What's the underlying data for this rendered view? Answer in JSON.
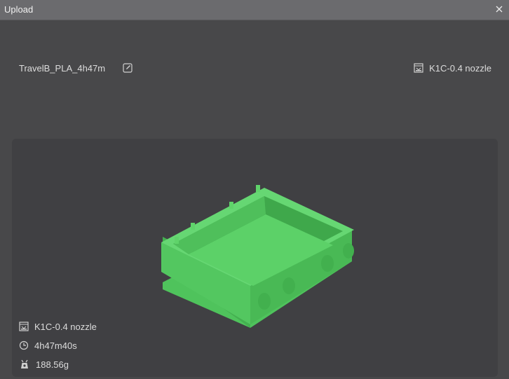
{
  "window": {
    "title": "Upload"
  },
  "header": {
    "filename": "TravelB_PLA_4h47m",
    "printer": "K1C-0.4 nozzle"
  },
  "details": {
    "printer": "K1C-0.4 nozzle",
    "print_time": "4h47m40s",
    "weight": "188.56g"
  },
  "icons": {
    "close": "close-icon",
    "edit": "edit-icon",
    "printer": "printer-icon",
    "clock": "clock-icon",
    "weight": "weight-icon"
  },
  "colors": {
    "model": "#5fd36a",
    "background": "#48484a",
    "preview_bg": "#404043"
  }
}
